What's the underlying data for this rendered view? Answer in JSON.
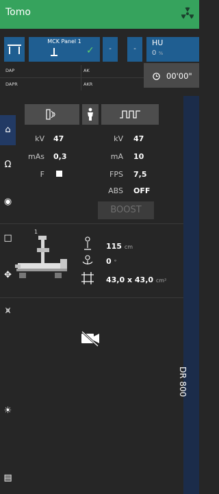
{
  "header": {
    "title": "Tomo",
    "icon": "radiation-icon"
  },
  "panel_bar": {
    "detector_label": "MCK Panel 1",
    "dash_a": "-",
    "dash_b": "-",
    "hu_label": "HU",
    "hu_value": "0",
    "hu_unit": "%"
  },
  "dose": {
    "dap": "DAP",
    "dapr": "DAPR",
    "ak": "AK",
    "akr": "AKR"
  },
  "timer": {
    "value": "00'00\""
  },
  "params_left": [
    {
      "label": "kV",
      "value": "47"
    },
    {
      "label": "mAs",
      "value": "0,3"
    },
    {
      "label": "F",
      "value": ""
    }
  ],
  "params_right": [
    {
      "label": "kV",
      "value": "47"
    },
    {
      "label": "mA",
      "value": "10"
    },
    {
      "label": "FPS",
      "value": "7,5"
    },
    {
      "label": "ABS",
      "value": "OFF"
    }
  ],
  "boost_label": "BOOST",
  "geometry": {
    "index": "1",
    "sid_value": "115",
    "sid_unit": "cm",
    "angle_value": "0",
    "angle_unit": "°",
    "field_value": "43,0 x 43,0",
    "field_unit": "cm²"
  },
  "sidebar": {
    "label": "DR 800",
    "items": [
      "home-icon",
      "patient-icon",
      "eye-icon",
      "square-icon",
      "move-icon",
      "collimator-icon",
      "light-icon",
      "note-icon"
    ]
  },
  "colors": {
    "header": "#36a35d",
    "panel": "#1f5e91",
    "sidebar": "#1b2c4a"
  }
}
